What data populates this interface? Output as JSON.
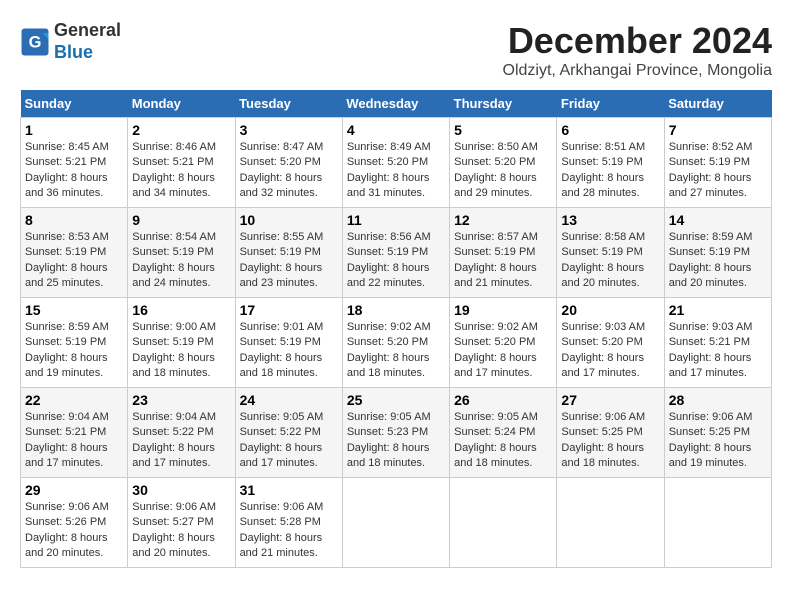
{
  "header": {
    "logo_line1": "General",
    "logo_line2": "Blue",
    "month_title": "December 2024",
    "location": "Oldziyt, Arkhangai Province, Mongolia"
  },
  "days_of_week": [
    "Sunday",
    "Monday",
    "Tuesday",
    "Wednesday",
    "Thursday",
    "Friday",
    "Saturday"
  ],
  "weeks": [
    [
      {
        "day": "1",
        "info": "Sunrise: 8:45 AM\nSunset: 5:21 PM\nDaylight: 8 hours\nand 36 minutes."
      },
      {
        "day": "2",
        "info": "Sunrise: 8:46 AM\nSunset: 5:21 PM\nDaylight: 8 hours\nand 34 minutes."
      },
      {
        "day": "3",
        "info": "Sunrise: 8:47 AM\nSunset: 5:20 PM\nDaylight: 8 hours\nand 32 minutes."
      },
      {
        "day": "4",
        "info": "Sunrise: 8:49 AM\nSunset: 5:20 PM\nDaylight: 8 hours\nand 31 minutes."
      },
      {
        "day": "5",
        "info": "Sunrise: 8:50 AM\nSunset: 5:20 PM\nDaylight: 8 hours\nand 29 minutes."
      },
      {
        "day": "6",
        "info": "Sunrise: 8:51 AM\nSunset: 5:19 PM\nDaylight: 8 hours\nand 28 minutes."
      },
      {
        "day": "7",
        "info": "Sunrise: 8:52 AM\nSunset: 5:19 PM\nDaylight: 8 hours\nand 27 minutes."
      }
    ],
    [
      {
        "day": "8",
        "info": "Sunrise: 8:53 AM\nSunset: 5:19 PM\nDaylight: 8 hours\nand 25 minutes."
      },
      {
        "day": "9",
        "info": "Sunrise: 8:54 AM\nSunset: 5:19 PM\nDaylight: 8 hours\nand 24 minutes."
      },
      {
        "day": "10",
        "info": "Sunrise: 8:55 AM\nSunset: 5:19 PM\nDaylight: 8 hours\nand 23 minutes."
      },
      {
        "day": "11",
        "info": "Sunrise: 8:56 AM\nSunset: 5:19 PM\nDaylight: 8 hours\nand 22 minutes."
      },
      {
        "day": "12",
        "info": "Sunrise: 8:57 AM\nSunset: 5:19 PM\nDaylight: 8 hours\nand 21 minutes."
      },
      {
        "day": "13",
        "info": "Sunrise: 8:58 AM\nSunset: 5:19 PM\nDaylight: 8 hours\nand 20 minutes."
      },
      {
        "day": "14",
        "info": "Sunrise: 8:59 AM\nSunset: 5:19 PM\nDaylight: 8 hours\nand 20 minutes."
      }
    ],
    [
      {
        "day": "15",
        "info": "Sunrise: 8:59 AM\nSunset: 5:19 PM\nDaylight: 8 hours\nand 19 minutes."
      },
      {
        "day": "16",
        "info": "Sunrise: 9:00 AM\nSunset: 5:19 PM\nDaylight: 8 hours\nand 18 minutes."
      },
      {
        "day": "17",
        "info": "Sunrise: 9:01 AM\nSunset: 5:19 PM\nDaylight: 8 hours\nand 18 minutes."
      },
      {
        "day": "18",
        "info": "Sunrise: 9:02 AM\nSunset: 5:20 PM\nDaylight: 8 hours\nand 18 minutes."
      },
      {
        "day": "19",
        "info": "Sunrise: 9:02 AM\nSunset: 5:20 PM\nDaylight: 8 hours\nand 17 minutes."
      },
      {
        "day": "20",
        "info": "Sunrise: 9:03 AM\nSunset: 5:20 PM\nDaylight: 8 hours\nand 17 minutes."
      },
      {
        "day": "21",
        "info": "Sunrise: 9:03 AM\nSunset: 5:21 PM\nDaylight: 8 hours\nand 17 minutes."
      }
    ],
    [
      {
        "day": "22",
        "info": "Sunrise: 9:04 AM\nSunset: 5:21 PM\nDaylight: 8 hours\nand 17 minutes."
      },
      {
        "day": "23",
        "info": "Sunrise: 9:04 AM\nSunset: 5:22 PM\nDaylight: 8 hours\nand 17 minutes."
      },
      {
        "day": "24",
        "info": "Sunrise: 9:05 AM\nSunset: 5:22 PM\nDaylight: 8 hours\nand 17 minutes."
      },
      {
        "day": "25",
        "info": "Sunrise: 9:05 AM\nSunset: 5:23 PM\nDaylight: 8 hours\nand 18 minutes."
      },
      {
        "day": "26",
        "info": "Sunrise: 9:05 AM\nSunset: 5:24 PM\nDaylight: 8 hours\nand 18 minutes."
      },
      {
        "day": "27",
        "info": "Sunrise: 9:06 AM\nSunset: 5:25 PM\nDaylight: 8 hours\nand 18 minutes."
      },
      {
        "day": "28",
        "info": "Sunrise: 9:06 AM\nSunset: 5:25 PM\nDaylight: 8 hours\nand 19 minutes."
      }
    ],
    [
      {
        "day": "29",
        "info": "Sunrise: 9:06 AM\nSunset: 5:26 PM\nDaylight: 8 hours\nand 20 minutes."
      },
      {
        "day": "30",
        "info": "Sunrise: 9:06 AM\nSunset: 5:27 PM\nDaylight: 8 hours\nand 20 minutes."
      },
      {
        "day": "31",
        "info": "Sunrise: 9:06 AM\nSunset: 5:28 PM\nDaylight: 8 hours\nand 21 minutes."
      },
      {
        "day": "",
        "info": ""
      },
      {
        "day": "",
        "info": ""
      },
      {
        "day": "",
        "info": ""
      },
      {
        "day": "",
        "info": ""
      }
    ]
  ]
}
